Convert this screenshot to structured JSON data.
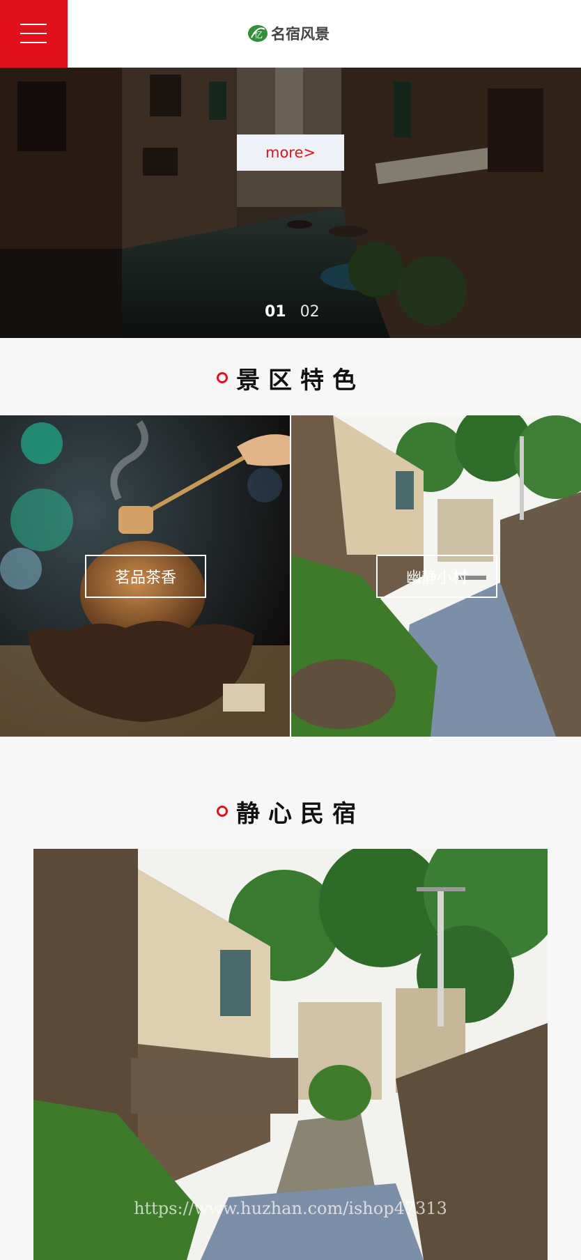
{
  "header": {
    "logo_text": "名宿风景",
    "menu_icon": "hamburger-menu-icon",
    "accent": "#e0101c"
  },
  "hero": {
    "more_label": "more>",
    "slides": [
      "01",
      "02"
    ],
    "active_slide": 0
  },
  "features": {
    "title": "景区特色",
    "tiles": [
      {
        "label": "茗品茶香"
      },
      {
        "label": "幽静小村"
      }
    ]
  },
  "homestay": {
    "title": "静心民宿"
  },
  "watermark": "https://www.huzhan.com/ishop47313"
}
